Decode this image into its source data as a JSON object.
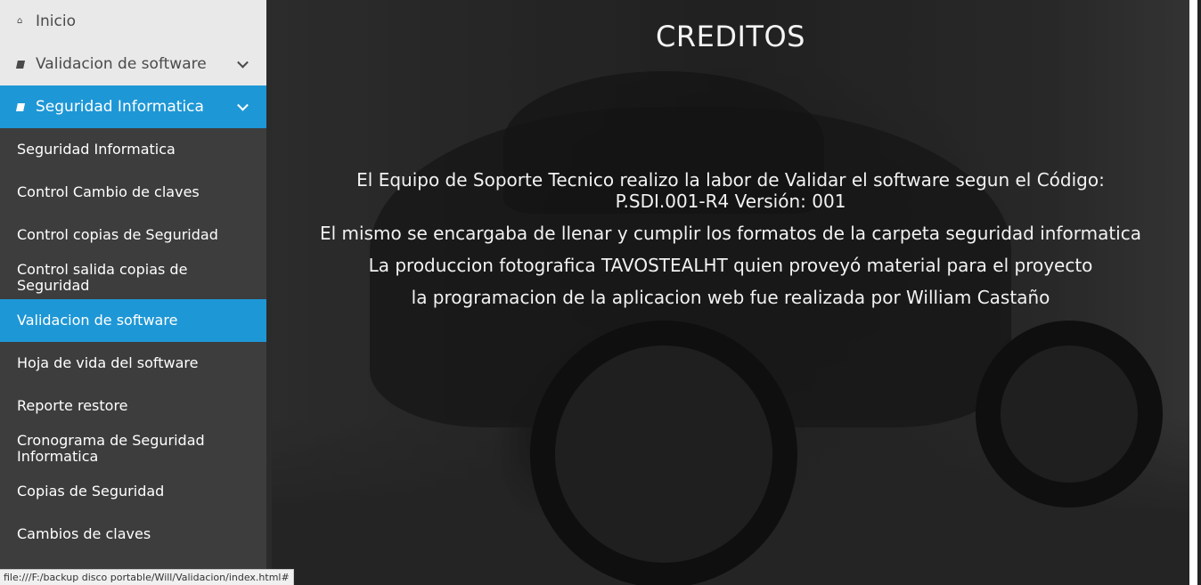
{
  "sidebar": {
    "top_items": [
      {
        "label": "Inicio",
        "icon": "home-icon"
      },
      {
        "label": "Validacion de software",
        "icon": "book-icon"
      },
      {
        "label": "Seguridad Informatica",
        "icon": "book-icon"
      }
    ],
    "sub_items": [
      "Seguridad Informatica",
      "Control Cambio de claves",
      "Control copias de Seguridad",
      "Control salida copias de Seguridad",
      "Validacion de software",
      "Hoja de vida del software",
      "Reporte restore",
      "Cronograma de Seguridad Informatica",
      "Copias de Seguridad",
      "Cambios de claves"
    ]
  },
  "main": {
    "title": "CREDITOS",
    "lines": [
      "El Equipo de Soporte Tecnico realizo la labor de Validar el software segun el Código: P.SDI.001-R4 Versión: 001",
      "El mismo se encargaba de llenar y cumplir los formatos de la carpeta seguridad informatica",
      "La produccion fotografica TAVOSTEALHT quien proveyó material para el proyecto",
      "la programacion de la aplicacion web fue realizada por William Castaño"
    ]
  },
  "status_bar": {
    "url": "file:///F:/backup disco portable/Will/Validacion/index.html#"
  },
  "colors": {
    "accent": "#1e97d6",
    "sidebar_bg": "#3d3d3d",
    "top_item_bg": "#e9e9e9"
  }
}
